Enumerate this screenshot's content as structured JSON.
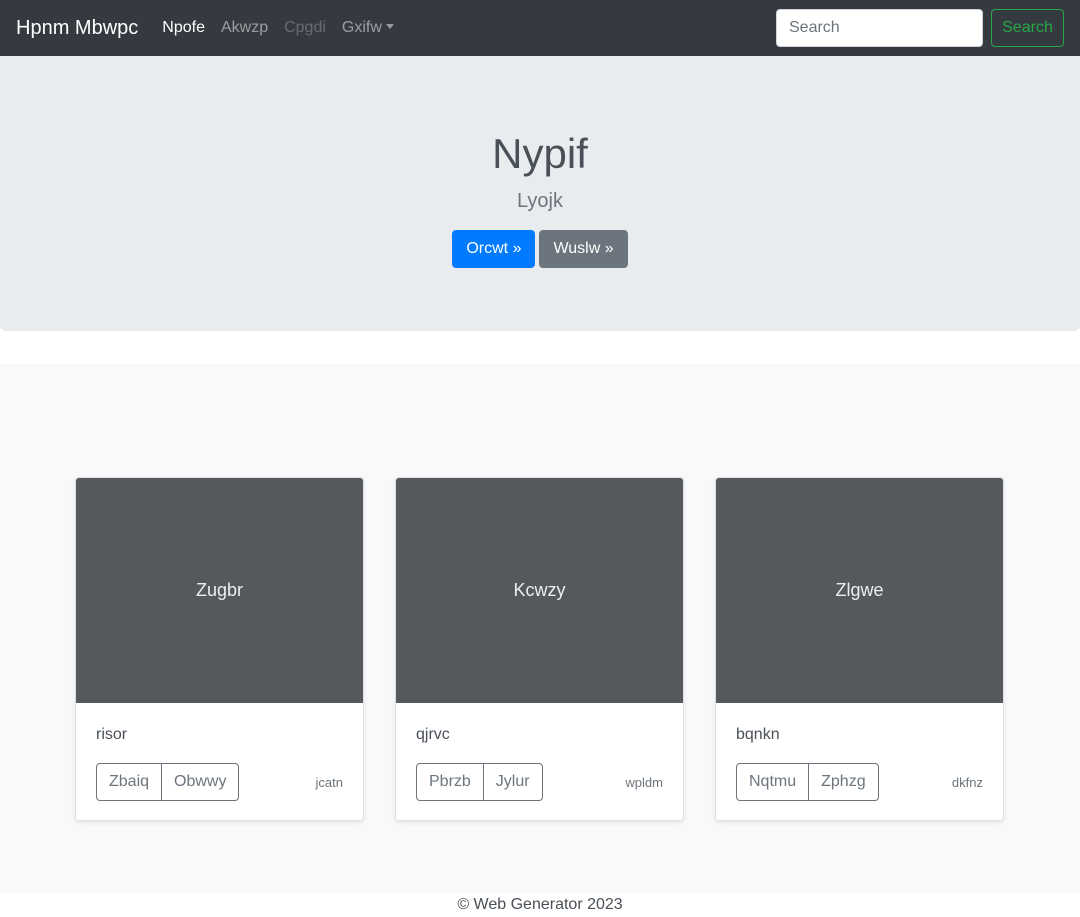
{
  "navbar": {
    "brand": "Hpnm Mbwpc",
    "links": [
      {
        "label": "Npofe",
        "state": "active"
      },
      {
        "label": "Akwzp",
        "state": "normal"
      },
      {
        "label": "Cpgdi",
        "state": "disabled"
      },
      {
        "label": "Gxifw",
        "state": "dropdown"
      }
    ],
    "search": {
      "placeholder": "Search",
      "value": "",
      "button_label": "Search"
    }
  },
  "hero": {
    "title": "Nypif",
    "subtitle": "Lyojk",
    "primary_button": "Orcwt »",
    "secondary_button": "Wuslw »"
  },
  "cards": [
    {
      "image_label": "Zugbr",
      "text": "risor",
      "button_1": "Zbaiq",
      "button_2": "Obwwy",
      "meta": "jcatn"
    },
    {
      "image_label": "Kcwzy",
      "text": "qjrvc",
      "button_1": "Pbrzb",
      "button_2": "Jylur",
      "meta": "wpldm"
    },
    {
      "image_label": "Zlgwe",
      "text": "bqnkn",
      "button_1": "Nqtmu",
      "button_2": "Zphzg",
      "meta": "dkfnz"
    }
  ],
  "footer": {
    "text": "© Web Generator 2023"
  },
  "colors": {
    "navbar_bg": "#343a40",
    "hero_bg": "#e9ecef",
    "primary": "#007bff",
    "secondary": "#6c757d",
    "success": "#28a745",
    "card_image_bg": "#55595c"
  }
}
